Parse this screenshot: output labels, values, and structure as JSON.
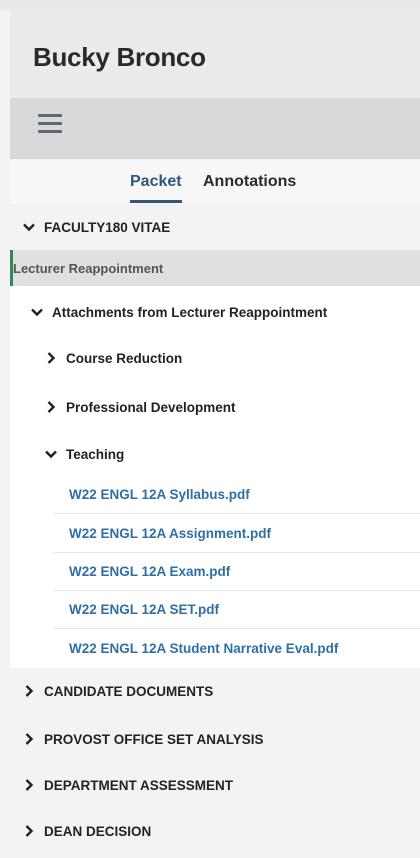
{
  "header": {
    "title": "Bucky Bronco"
  },
  "toolbar": {
    "menu_icon": "hamburger-icon"
  },
  "tabs": [
    {
      "label": "Packet",
      "active": true
    },
    {
      "label": "Annotations",
      "active": false
    }
  ],
  "sections": {
    "faculty180": {
      "label": "FACULTY180 VITAE",
      "expanded": true
    },
    "selected_item": {
      "label": "Lecturer Reappointment"
    },
    "attachments": {
      "label": "Attachments from Lecturer Reappointment",
      "expanded": true
    },
    "course_reduction": {
      "label": "Course Reduction",
      "expanded": false
    },
    "professional_development": {
      "label": "Professional Development",
      "expanded": false
    },
    "teaching": {
      "label": "Teaching",
      "expanded": true
    },
    "files": [
      "W22 ENGL 12A Syllabus.pdf",
      "W22 ENGL 12A Assignment.pdf",
      "W22 ENGL 12A Exam.pdf",
      "W22 ENGL 12A SET.pdf",
      "W22 ENGL 12A Student Narrative Eval.pdf"
    ],
    "candidate_documents": {
      "label": "CANDIDATE DOCUMENTS",
      "expanded": false
    },
    "provost_office": {
      "label": "PROVOST OFFICE SET ANALYSIS",
      "expanded": false
    },
    "department_assessment": {
      "label": "DEPARTMENT ASSESSMENT",
      "expanded": false
    },
    "dean_decision": {
      "label": "DEAN DECISION",
      "expanded": false
    }
  },
  "colors": {
    "accent": "#31577b",
    "link": "#2f6fa5",
    "selected_marker": "#2e8b57"
  }
}
